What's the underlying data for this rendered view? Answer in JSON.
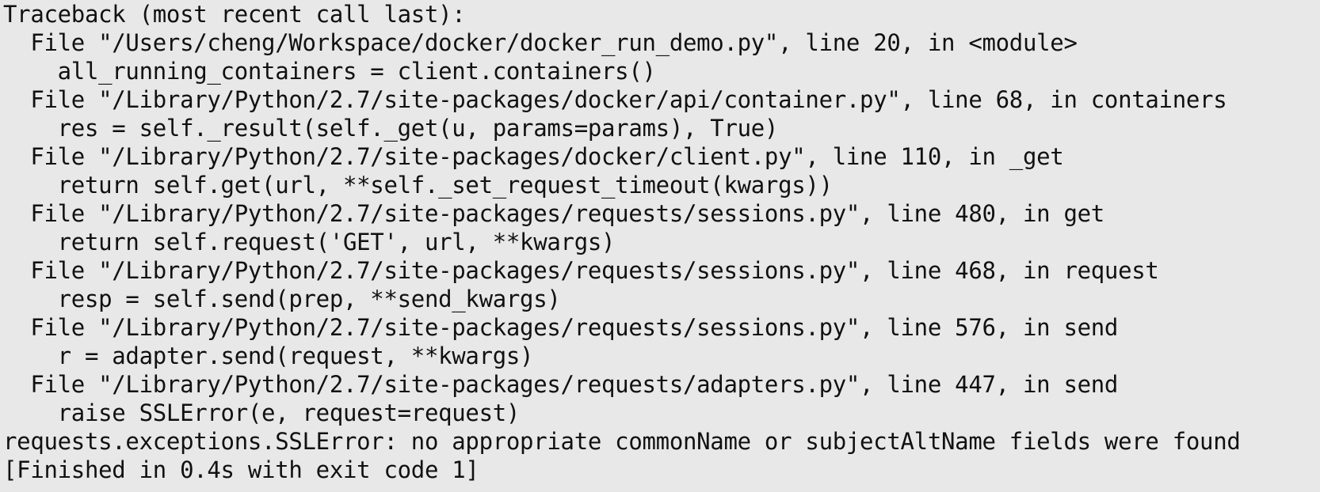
{
  "console": {
    "lines": [
      "Traceback (most recent call last):",
      "  File \"/Users/cheng/Workspace/docker/docker_run_demo.py\", line 20, in <module>",
      "    all_running_containers = client.containers()",
      "  File \"/Library/Python/2.7/site-packages/docker/api/container.py\", line 68, in containers",
      "    res = self._result(self._get(u, params=params), True)",
      "  File \"/Library/Python/2.7/site-packages/docker/client.py\", line 110, in _get",
      "    return self.get(url, **self._set_request_timeout(kwargs))",
      "  File \"/Library/Python/2.7/site-packages/requests/sessions.py\", line 480, in get",
      "    return self.request('GET', url, **kwargs)",
      "  File \"/Library/Python/2.7/site-packages/requests/sessions.py\", line 468, in request",
      "    resp = self.send(prep, **send_kwargs)",
      "  File \"/Library/Python/2.7/site-packages/requests/sessions.py\", line 576, in send",
      "    r = adapter.send(request, **kwargs)",
      "  File \"/Library/Python/2.7/site-packages/requests/adapters.py\", line 447, in send",
      "    raise SSLError(e, request=request)",
      "requests.exceptions.SSLError: no appropriate commonName or subjectAltName fields were found",
      "[Finished in 0.4s with exit code 1]"
    ]
  },
  "colors": {
    "background": "#e8e8e8",
    "text": "#111111"
  }
}
